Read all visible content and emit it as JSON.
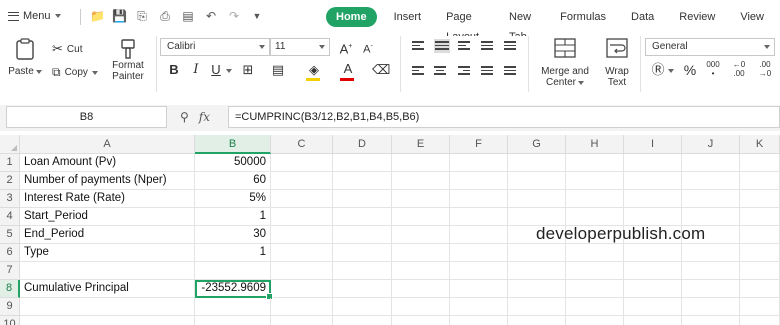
{
  "menu": {
    "label": "Menu"
  },
  "tabs": [
    {
      "label": "Home",
      "active": true
    },
    {
      "label": "Insert",
      "active": false
    },
    {
      "label": "Page Layout",
      "active": false
    },
    {
      "label": "New Tab",
      "active": false
    },
    {
      "label": "Formulas",
      "active": false
    },
    {
      "label": "Data",
      "active": false
    },
    {
      "label": "Review",
      "active": false
    },
    {
      "label": "View",
      "active": false
    }
  ],
  "ribbon": {
    "paste_label": "Paste",
    "cut_label": "Cut",
    "copy_label": "Copy",
    "format_painter_line1": "Format",
    "format_painter_line2": "Painter",
    "font_name": "Calibri",
    "font_size": "11",
    "bold": "B",
    "italic": "I",
    "underline": "U",
    "merge_line1": "Merge and",
    "merge_line2": "Center",
    "wrap_line1": "Wrap",
    "wrap_line2": "Text",
    "number_format": "General",
    "percent": "%",
    "thousands": "000"
  },
  "formula_bar": {
    "name_box": "B8",
    "fx": "fx",
    "formula": "=CUMPRINC(B3/12,B2,B1,B4,B5,B6)"
  },
  "sheet": {
    "columns": [
      "A",
      "B",
      "C",
      "D",
      "E",
      "F",
      "G",
      "H",
      "I",
      "J",
      "K"
    ],
    "selected_column": "B",
    "selected_row": "8",
    "rows": [
      {
        "n": "1",
        "a": "Loan Amount (Pv)",
        "b": "50000"
      },
      {
        "n": "2",
        "a": "Number of payments (Nper)",
        "b": "60"
      },
      {
        "n": "3",
        "a": "Interest Rate (Rate)",
        "b": "5%"
      },
      {
        "n": "4",
        "a": "Start_Period",
        "b": "1"
      },
      {
        "n": "5",
        "a": "End_Period",
        "b": "30"
      },
      {
        "n": "6",
        "a": "Type",
        "b": "1"
      },
      {
        "n": "7",
        "a": "",
        "b": ""
      },
      {
        "n": "8",
        "a": "Cumulative Principal",
        "b": "-23552.9609"
      },
      {
        "n": "9",
        "a": "",
        "b": ""
      },
      {
        "n": "10",
        "a": "",
        "b": ""
      }
    ]
  },
  "watermark": "developerpublish.com",
  "colors": {
    "accent": "#21a366"
  }
}
